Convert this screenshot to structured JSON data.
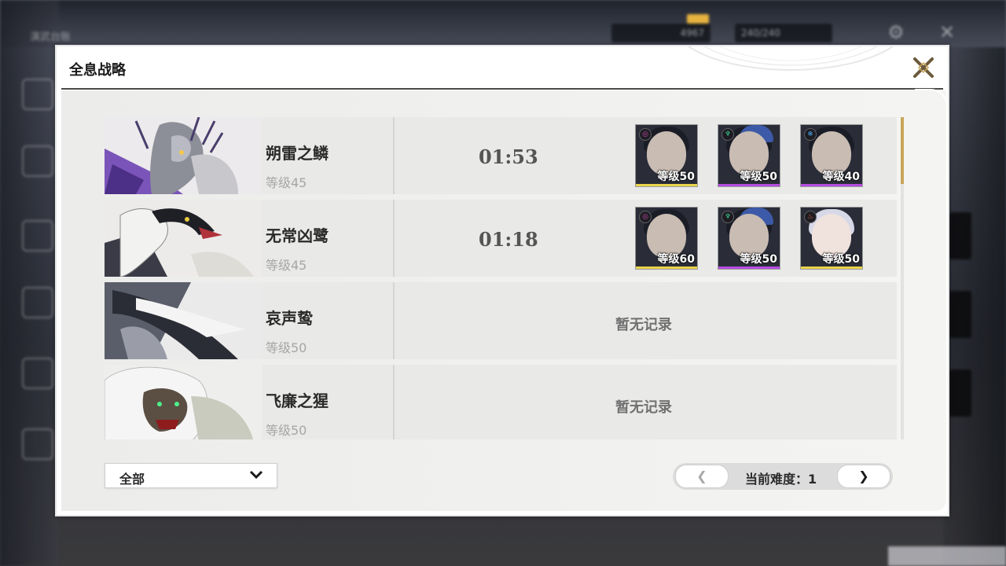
{
  "background": {
    "top_title": "演武台账",
    "resources": [
      "4967",
      "240/240"
    ],
    "colors": {
      "resource_badge": "#e6b340"
    }
  },
  "dialog": {
    "title": "全息战略",
    "close_icon": "x-close-icon"
  },
  "bosses": [
    {
      "name": "朔雷之鳞",
      "level": "等级45",
      "time": "01:53",
      "team": [
        {
          "level": "等级50",
          "element": "electro",
          "element_color": "#d04fb3",
          "bar_color": "#e9d44a",
          "hat": false
        },
        {
          "level": "等级50",
          "element": "aero",
          "element_color": "#3fce8c",
          "bar_color": "#b54cdf",
          "hat": true
        },
        {
          "level": "等级40",
          "element": "glacio",
          "element_color": "#4aa8f0",
          "bar_color": "#b54cdf",
          "hat": false
        }
      ]
    },
    {
      "name": "无常凶鹭",
      "level": "等级45",
      "time": "01:18",
      "team": [
        {
          "level": "等级60",
          "element": "electro",
          "element_color": "#d04fb3",
          "bar_color": "#e9d44a",
          "hat": false
        },
        {
          "level": "等级50",
          "element": "aero",
          "element_color": "#3fce8c",
          "bar_color": "#b54cdf",
          "hat": true
        },
        {
          "level": "等级50",
          "element": "fusion",
          "element_color": "#e85a3a",
          "bar_color": "#e9d44a",
          "hat": false
        }
      ]
    },
    {
      "name": "哀声鸷",
      "level": "等级50",
      "empty_text": "暂无记录"
    },
    {
      "name": "飞廉之猩",
      "level": "等级50",
      "empty_text": "暂无记录"
    }
  ],
  "filter": {
    "selected": "全部",
    "icon": "chevron-down-icon"
  },
  "pager": {
    "prev": "❮",
    "next": "❯",
    "label": "当前难度：",
    "value": "1",
    "text": "当前难度：1"
  },
  "colors": {
    "scroll_thumb": "#c9a65a",
    "accent_gold": "#c9a65a"
  }
}
